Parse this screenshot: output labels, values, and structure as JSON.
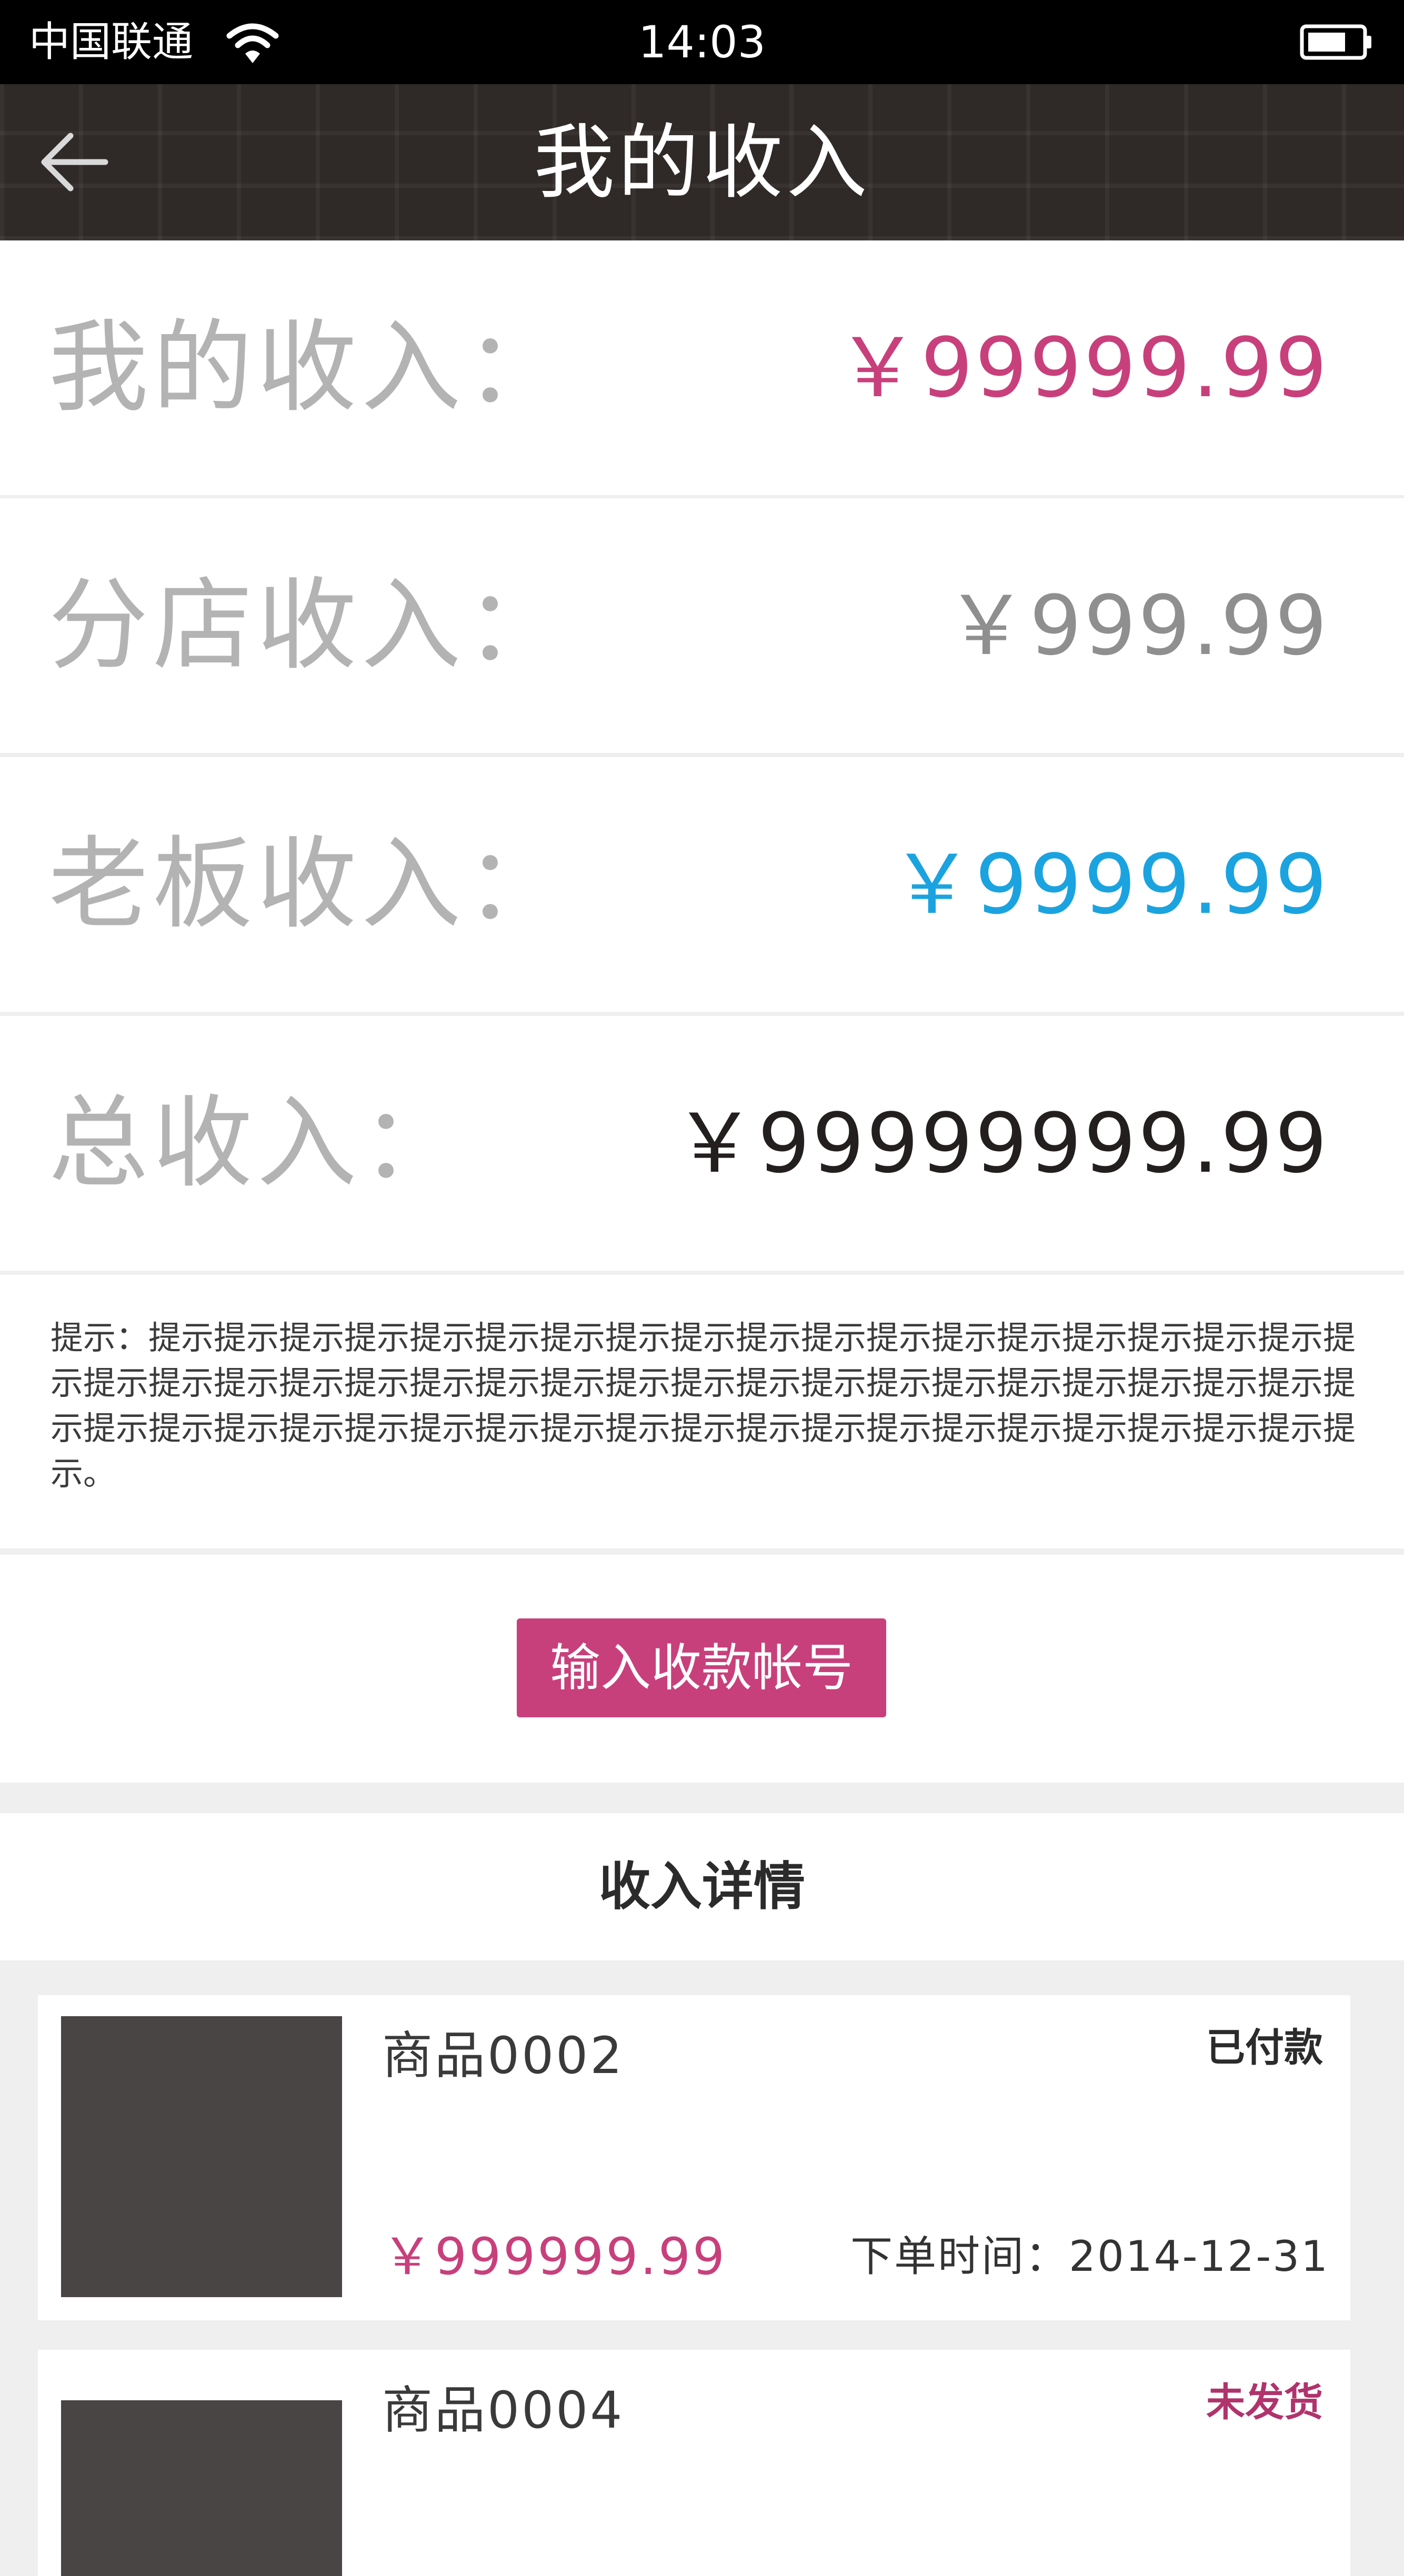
{
  "status_bar": {
    "carrier": "中国联通",
    "time": "14:03"
  },
  "nav": {
    "title": "我的收入"
  },
  "income_rows": [
    {
      "label": "我的收入：",
      "value": "￥99999.99",
      "color": "#c8407b"
    },
    {
      "label": "分店收入：",
      "value": "￥999.99",
      "color": "#8f8f8f"
    },
    {
      "label": "老板收入：",
      "value": "￥9999.99",
      "color": "#1ba3e0"
    },
    {
      "label": "总收入：",
      "value": "￥99999999.99",
      "color": "#231f1f"
    }
  ],
  "tip": "提示：提示提示提示提示提示提示提示提示提示提示提示提示提示提示提示提示提示提示提示提示提示提示提示提示提示提示提示提示提示提示提示提示提示提示提示提示提示提示提示提示提示提示提示提示提示提示提示提示提示提示提示提示提示提示提示提示提示提示提示。",
  "button_label": "输入收款帐号",
  "section_title": "收入详情",
  "orders": [
    {
      "name": "商品0002",
      "status": "已付款",
      "status_color": "#2b2b2b",
      "price": "￥999999.99",
      "time": "下单时间：2014-12-31"
    },
    {
      "name": "商品0004",
      "status": "未发货",
      "status_color": "#b0336c"
    }
  ],
  "icons": [
    "wifi-icon",
    "battery-icon",
    "back-arrow-icon"
  ]
}
